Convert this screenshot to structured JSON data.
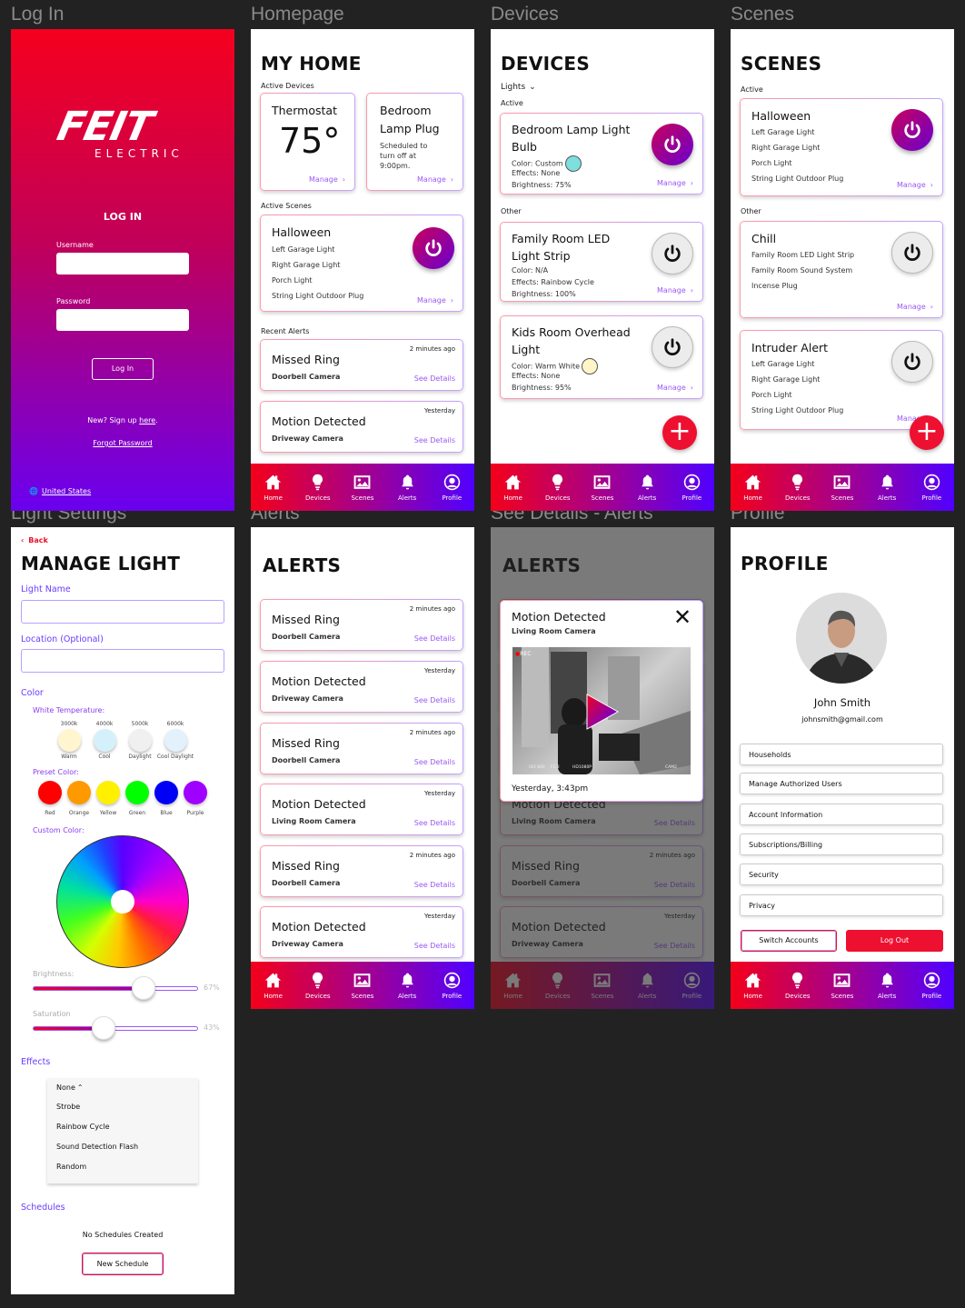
{
  "screen_labels": [
    "Log In",
    "Homepage",
    "Devices",
    "Scenes",
    "Light Settings",
    "Alerts",
    "See Details - Alerts",
    "Profile"
  ],
  "colors": {
    "brand_red": "#f4001a",
    "brand_purple": "#5000ff",
    "link_purple": "#9b59f5",
    "logout_red": "#ee1030"
  },
  "nav": [
    {
      "label": "Home",
      "icon": "home-icon"
    },
    {
      "label": "Devices",
      "icon": "lightbulb-icon"
    },
    {
      "label": "Scenes",
      "icon": "image-icon"
    },
    {
      "label": "Alerts",
      "icon": "bell-icon"
    },
    {
      "label": "Profile",
      "icon": "user-circle-icon"
    }
  ],
  "login": {
    "logo": "FEIT",
    "logo_sub": "ELECTRIC",
    "title": "LOG IN",
    "username_label": "Username",
    "username_value": "",
    "password_label": "Password",
    "password_value": "",
    "button": "Log In",
    "signup_text": "New? Sign up ",
    "signup_link": "here",
    "signup_end": ".",
    "forgot": "Forgot Password",
    "region": "United States"
  },
  "home": {
    "title": "MY HOME",
    "active_devices": "Active Devices",
    "thermostat": {
      "title": "Thermostat",
      "value": "75°",
      "manage": "Manage"
    },
    "plug": {
      "title": "Bedroom Lamp Plug",
      "desc": "Scheduled to turn off at 9:00pm.",
      "manage": "Manage"
    },
    "active_scenes": "Active Scenes",
    "scene": {
      "title": "Halloween",
      "items": [
        "Left Garage Light",
        "Right Garage Light",
        "Porch Light",
        "String Light Outdoor Plug"
      ],
      "manage": "Manage",
      "on": true
    },
    "recent_alerts": "Recent Alerts",
    "alerts": [
      {
        "title": "Missed Ring",
        "source": "Doorbell Camera",
        "time": "2 minutes ago",
        "link": "See Details"
      },
      {
        "title": "Motion Detected",
        "source": "Driveway Camera",
        "time": "Yesterday",
        "link": "See Details"
      }
    ]
  },
  "devices": {
    "title": "DEVICES",
    "filter": "Lights",
    "active_label": "Active",
    "other_label": "Other",
    "active": [
      {
        "title": "Bedroom Lamp Light Bulb",
        "lines": [
          "Color: Custom",
          "Effects: None",
          "Brightness: 75%"
        ],
        "swatch": "#7fdede",
        "on": true,
        "manage": "Manage"
      }
    ],
    "other": [
      {
        "title": "Family Room LED Light Strip",
        "lines": [
          "Color: N/A",
          "Effects: Rainbow Cycle",
          "Brightness: 100%"
        ],
        "swatch": null,
        "on": false,
        "manage": "Manage"
      },
      {
        "title": "Kids Room Overhead Light",
        "lines": [
          "Color: Warm White",
          "Effects: None",
          "Brightness: 95%"
        ],
        "swatch": "#fff6c8",
        "on": false,
        "manage": "Manage"
      }
    ]
  },
  "scenes": {
    "title": "SCENES",
    "active_label": "Active",
    "other_label": "Other",
    "active": [
      {
        "title": "Halloween",
        "items": [
          "Left Garage Light",
          "Right Garage Light",
          "Porch Light",
          "String Light Outdoor Plug"
        ],
        "on": true,
        "manage": "Manage"
      }
    ],
    "other": [
      {
        "title": "Chill",
        "items": [
          "Family Room LED Light Strip",
          "Family Room Sound System",
          "Incense Plug"
        ],
        "on": false,
        "manage": "Manage"
      },
      {
        "title": "Intruder Alert",
        "items": [
          "Left Garage Light",
          "Right Garage Light",
          "Porch Light",
          "String Light Outdoor Plug"
        ],
        "on": false,
        "manage": "Manage"
      }
    ]
  },
  "light": {
    "back": "Back",
    "title": "MANAGE LIGHT",
    "name_label": "Light Name",
    "name_value": "",
    "location_label": "Location (Optional)",
    "location_value": "",
    "color_label": "Color",
    "white_temp_label": "White Temperature:",
    "white_temps": [
      {
        "k": "3000k",
        "name": "Warm",
        "color": "#fff6cf"
      },
      {
        "k": "4000k",
        "name": "Cool",
        "color": "#d4f1fb"
      },
      {
        "k": "5000k",
        "name": "Daylight",
        "color": "#f0f0f0"
      },
      {
        "k": "6000k",
        "name": "Cool Daylight",
        "color": "#e2f1fb"
      }
    ],
    "preset_label": "Preset Color:",
    "presets": [
      {
        "name": "Red",
        "color": "#ff0000"
      },
      {
        "name": "Orange",
        "color": "#ff9900"
      },
      {
        "name": "Yellow",
        "color": "#fff000"
      },
      {
        "name": "Green",
        "color": "#00ff00"
      },
      {
        "name": "Blue",
        "color": "#0000f5"
      },
      {
        "name": "Purple",
        "color": "#a000ff"
      }
    ],
    "custom_label": "Custom Color:",
    "brightness_label": "Brightness:",
    "brightness": 67,
    "brightness_text": "67%",
    "saturation_label": "Saturation",
    "saturation": 43,
    "saturation_text": "43%",
    "effects_label": "Effects",
    "effects_selected": "None",
    "effects_options": [
      "Strobe",
      "Rainbow Cycle",
      "Sound Detection Flash",
      "Random"
    ],
    "schedules_label": "Schedules",
    "no_schedules": "No Schedules Created",
    "new_schedule": "New Schedule"
  },
  "alerts": {
    "title": "ALERTS",
    "items": [
      {
        "title": "Missed Ring",
        "source": "Doorbell Camera",
        "time": "2 minutes ago",
        "link": "See Details"
      },
      {
        "title": "Motion Detected",
        "source": "Driveway Camera",
        "time": "Yesterday",
        "link": "See Details"
      },
      {
        "title": "Missed Ring",
        "source": "Doorbell Camera",
        "time": "2 minutes ago",
        "link": "See Details"
      },
      {
        "title": "Motion Detected",
        "source": "Living Room Camera",
        "time": "Yesterday",
        "link": "See Details"
      },
      {
        "title": "Missed Ring",
        "source": "Doorbell Camera",
        "time": "2 minutes ago",
        "link": "See Details"
      },
      {
        "title": "Motion Detected",
        "source": "Driveway Camera",
        "time": "Yesterday",
        "link": "See Details"
      }
    ]
  },
  "details": {
    "modal_title": "Motion Detected",
    "modal_source": "Living Room Camera",
    "timestamp": "Yesterday, 3:43pm",
    "video_rec": "REC",
    "video_meta": [
      "ISO 800",
      "F2.2",
      "HD1080P"
    ],
    "video_cam": "CAM2"
  },
  "profile": {
    "title": "PROFILE",
    "name": "John Smith",
    "email": "johnsmith@gmail.com",
    "menu": [
      "Households",
      "Manage Authorized Users",
      "Account Information",
      "Subscriptions/Billing",
      "Security",
      "Privacy"
    ],
    "switch": "Switch Accounts",
    "logout": "Log Out"
  }
}
